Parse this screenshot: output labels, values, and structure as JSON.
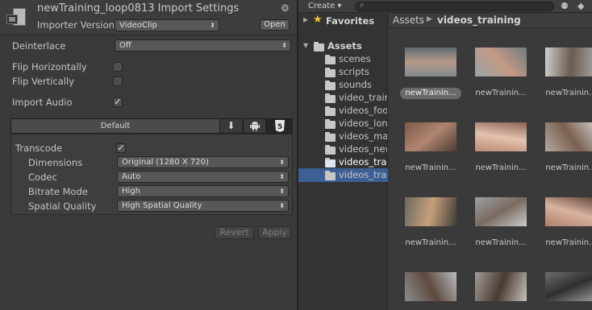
{
  "inspector": {
    "title": "newTraining_loop0813 Import Settings",
    "importer_version_label": "Importer Version",
    "importer_version_value": "VideoClip",
    "open_button": "Open",
    "deinterlace_label": "Deinterlace",
    "deinterlace_value": "Off",
    "flip_horizontally_label": "Flip Horizontally",
    "flip_horizontally_checked": false,
    "flip_vertically_label": "Flip Vertically",
    "flip_vertically_checked": false,
    "import_audio_label": "Import Audio",
    "import_audio_checked": true,
    "check_glyph": "✓",
    "platform_tabs": {
      "default_label": "Default",
      "icons": [
        "download-icon",
        "android-icon",
        "html5-icon"
      ],
      "html5_glyph": "5"
    },
    "transcode_label": "Transcode",
    "transcode_checked": true,
    "dimensions_label": "Dimensions",
    "dimensions_value": "Original (1280 X 720)",
    "codec_label": "Codec",
    "codec_value": "Auto",
    "bitrate_label": "Bitrate Mode",
    "bitrate_value": "High",
    "spatial_label": "Spatial Quality",
    "spatial_value": "High Spatial Quality",
    "revert_button": "Revert",
    "apply_button": "Apply"
  },
  "project": {
    "create_label": "Create ▾",
    "favorites_label": "Favorites",
    "assets_label": "Assets",
    "folders": [
      "scenes",
      "scripts",
      "sounds",
      "video_trair",
      "videos_foo",
      "videos_lon",
      "videos_ma",
      "videos_new",
      "videos_tra",
      "videos_tra"
    ],
    "selected_folder_index": 8,
    "breadcrumb": [
      "Assets",
      "videos_training"
    ],
    "thumbnails": [
      {
        "label": "newTrainin...",
        "colors": [
          "#7f8a8f",
          "#b59a8a",
          "#5e6a70"
        ],
        "selected": true
      },
      {
        "label": "newTrainin...",
        "colors": [
          "#9aa2a6",
          "#c49a84",
          "#6f7a80"
        ],
        "selected": false
      },
      {
        "label": "newTrainin...",
        "colors": [
          "#cfd0cf",
          "#6b5a50",
          "#a8a9a8"
        ],
        "selected": false
      },
      {
        "label": "newTrainin...",
        "colors": [
          "#7a5a4a",
          "#b08570",
          "#4d3b33"
        ],
        "selected": false
      },
      {
        "label": "newTrainin...",
        "colors": [
          "#b98a74",
          "#e4c2b0",
          "#8a6452"
        ],
        "selected": false
      },
      {
        "label": "newTrainin...",
        "colors": [
          "#b4a9a0",
          "#7a6050",
          "#d0ccc6"
        ],
        "selected": false
      },
      {
        "label": "newTrainin...",
        "colors": [
          "#6c6a62",
          "#c7a07a",
          "#3f3d38"
        ],
        "selected": false
      },
      {
        "label": "newTrainin...",
        "colors": [
          "#9ca2a7",
          "#7a6a60",
          "#c9cccd"
        ],
        "selected": false
      },
      {
        "label": "newTrainin...",
        "colors": [
          "#b07f6a",
          "#d9b3a0",
          "#5d4237"
        ],
        "selected": false
      },
      {
        "label": "",
        "colors": [
          "#8a8c8d",
          "#5f4a40",
          "#b8bcbd"
        ],
        "selected": false
      },
      {
        "label": "",
        "colors": [
          "#a19d98",
          "#4a3a33",
          "#c6c3be"
        ],
        "selected": false
      },
      {
        "label": "",
        "colors": [
          "#6e6e6e",
          "#2f2f2f",
          "#9a9a9a"
        ],
        "selected": false
      }
    ]
  },
  "colors": {
    "selection": "#3e5f96",
    "favorites_star": "#f2c233"
  }
}
